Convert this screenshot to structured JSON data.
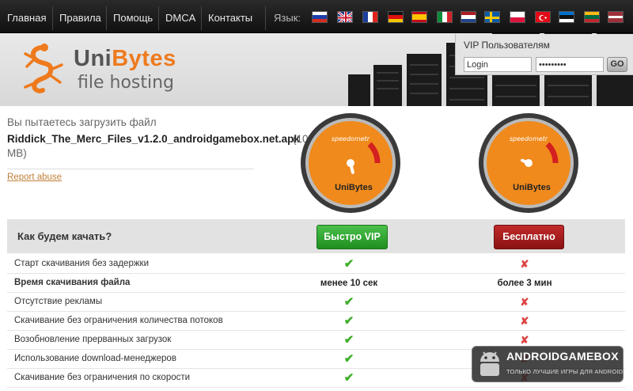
{
  "nav": {
    "items": [
      "Главная",
      "Правила",
      "Помощь",
      "DMCA",
      "Контакты"
    ],
    "language_label": "Язык:",
    "flags": [
      "ru",
      "gb",
      "fr",
      "de",
      "es",
      "it",
      "nl",
      "se",
      "pl",
      "tr",
      "ee",
      "lt",
      "lv"
    ]
  },
  "logo": {
    "name_part1": "Uni",
    "name_part2": "Bytes",
    "subtitle": "file hosting"
  },
  "vip": {
    "title": "VIP Пользователям",
    "login_value": "Login",
    "password_value": "•••••••••",
    "go_label": "GO"
  },
  "file": {
    "intro": "Вы пытаетесь загрузить файл",
    "name": "Riddick_The_Merc_Files_v1.2.0_androidgamebox.net.apk",
    "size_open": "(10",
    "size_close": "MB)",
    "report_label": "Report abuse"
  },
  "gauges": {
    "label": "speedometr",
    "brand": "UniBytes",
    "fill_color": "#f08a1c",
    "rim_color": "#3a3a3a",
    "vip_needle_pct": 0.62,
    "free_needle_pct": 0.5
  },
  "compare": {
    "question": "Как будем качать?",
    "vip_button": "Быстро VIP",
    "free_button": "Бесплатно",
    "rows": [
      {
        "label": "Старт скачивания без задержки",
        "vip": "check",
        "free": "cross",
        "bold": false
      },
      {
        "label": "Время скачивания файла",
        "vip": "менее 10 сек",
        "free": "более 3 мин",
        "bold": true
      },
      {
        "label": "Отсутствие рекламы",
        "vip": "check",
        "free": "cross",
        "bold": false
      },
      {
        "label": "Скачивание без ограничения количества потоков",
        "vip": "check",
        "free": "cross",
        "bold": false
      },
      {
        "label": "Возобновление прерванных загрузок",
        "vip": "check",
        "free": "cross",
        "bold": false
      },
      {
        "label": "Использование download-менеджеров",
        "vip": "check",
        "free": "cross",
        "bold": false
      },
      {
        "label": "Скачивание без ограничения по скорости",
        "vip": "check",
        "free": "cross",
        "bold": false
      }
    ],
    "check_glyph": "✔",
    "cross_glyph": "✘"
  },
  "watermark": {
    "title": "ANDROIDGAMEBOX",
    "subtitle": "ТОЛЬКО ЛУЧШИЕ ИГРЫ ДЛЯ ANDROID"
  }
}
